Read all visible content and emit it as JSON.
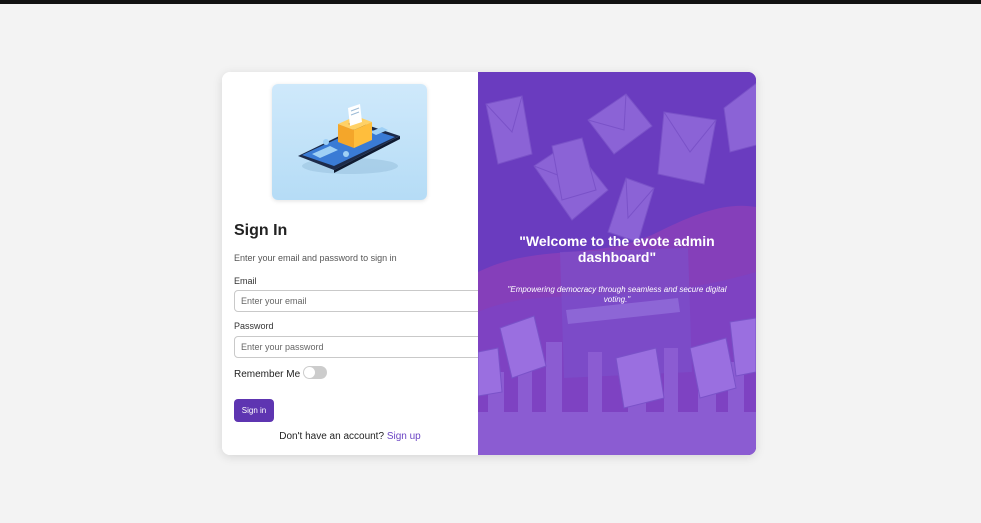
{
  "signin": {
    "title": "Sign In",
    "subtitle": "Enter your email and password to sign in",
    "email_label": "Email",
    "email_placeholder": "Enter your email",
    "password_label": "Password",
    "password_placeholder": "Enter your password",
    "remember_label": "Remember Me",
    "remember_checked": false,
    "button_label": "Sign in",
    "no_account_text": "Don't have an account?",
    "signup_link": "Sign up",
    "illustration_icon": "phone-ballot-icon"
  },
  "promo": {
    "headline": "\"Welcome to the evote admin dashboard\"",
    "tagline": "\"Empowering democracy through seamless and secure digital voting.\""
  },
  "colors": {
    "primary": "#5e35b1",
    "panel_bg": "#6a3cbf",
    "page_bg": "#f3f3f3"
  }
}
